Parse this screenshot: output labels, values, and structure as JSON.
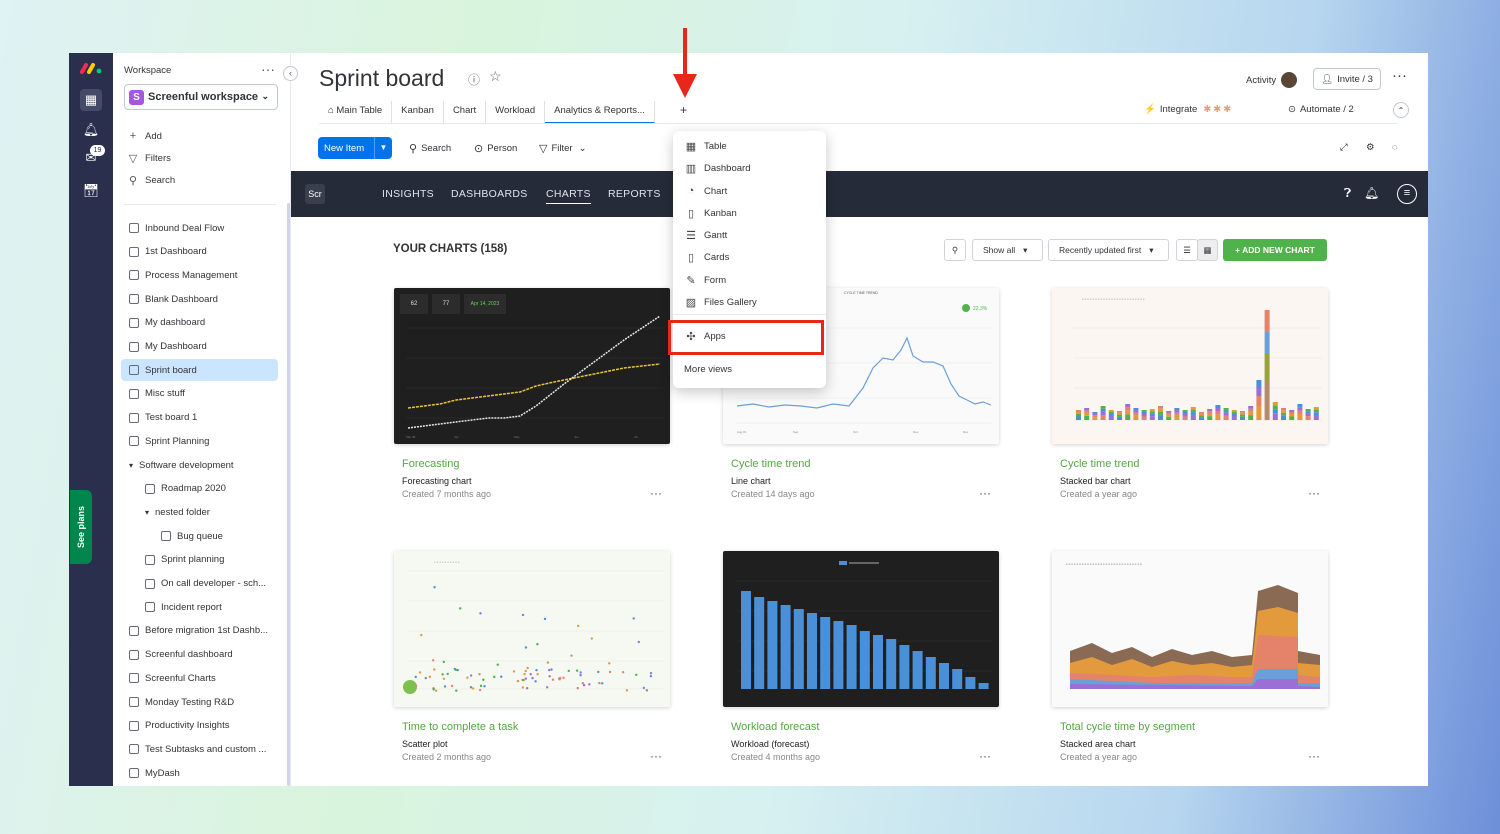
{
  "sidebar": {
    "workspace_label": "Workspace",
    "workspace_name": "Screenful workspace",
    "workspace_initial": "S",
    "actions": [
      {
        "label": "Add",
        "icon": "plus-icon"
      },
      {
        "label": "Filters",
        "icon": "filter-icon"
      },
      {
        "label": "Search",
        "icon": "search-icon"
      }
    ],
    "items": [
      "Inbound Deal Flow",
      "1st Dashboard",
      "Process Management",
      "Blank Dashboard",
      "My dashboard",
      "My Dashboard",
      "Sprint board",
      "Misc stuff",
      "Test board 1",
      "Sprint Planning",
      "Software development",
      "Roadmap 2020",
      "nested folder",
      "Bug queue",
      "Sprint planning",
      "On call developer - sch...",
      "Incident report",
      "Before migration 1st Dashb...",
      "Screenful dashboard",
      "Screenful Charts",
      "Monday Testing R&D",
      "Productivity Insights",
      "Test Subtasks and custom ...",
      "MyDash"
    ],
    "selected": "Sprint board"
  },
  "rail": {
    "see_plans": "See plans",
    "notif_count": "19"
  },
  "header": {
    "title": "Sprint board",
    "activity": "Activity",
    "invite": "Invite / 3",
    "tabs": [
      "Main Table",
      "Kanban",
      "Chart",
      "Workload",
      "Analytics & Reports..."
    ],
    "active_tab": "Analytics & Reports...",
    "add_view": "+",
    "integrate": "Integrate",
    "automate": "Automate / 2"
  },
  "toolbar": {
    "new_item": "New Item",
    "search": "Search",
    "person": "Person",
    "filter": "Filter"
  },
  "screenful": {
    "logo": "Scr",
    "nav": [
      "INSIGHTS",
      "DASHBOARDS",
      "CHARTS",
      "REPORTS"
    ],
    "active": "CHARTS"
  },
  "charts_page": {
    "heading": "YOUR CHARTS (158)",
    "show_all": "Show all",
    "sort": "Recently updated first",
    "add_new": "+ ADD NEW CHART",
    "cards": [
      {
        "title": "Forecasting",
        "subtitle": "Forecasting chart",
        "date": "Created 7 months ago"
      },
      {
        "title": "Cycle time trend",
        "subtitle": "Line chart",
        "date": "Created 14 days ago"
      },
      {
        "title": "Cycle time trend",
        "subtitle": "Stacked bar chart",
        "date": "Created a year ago"
      },
      {
        "title": "Time to complete a task",
        "subtitle": "Scatter plot",
        "date": "Created 2 months ago"
      },
      {
        "title": "Workload forecast",
        "subtitle": "Workload (forecast)",
        "date": "Created 4 months ago"
      },
      {
        "title": "Total cycle time by segment",
        "subtitle": "Stacked area chart",
        "date": "Created a year ago"
      }
    ]
  },
  "add_view_menu": {
    "items": [
      {
        "label": "Table",
        "icon": "table-icon"
      },
      {
        "label": "Dashboard",
        "icon": "dashboard-icon"
      },
      {
        "label": "Chart",
        "icon": "chart-icon"
      },
      {
        "label": "Kanban",
        "icon": "kanban-icon"
      },
      {
        "label": "Gantt",
        "icon": "gantt-icon"
      },
      {
        "label": "Cards",
        "icon": "cards-icon"
      },
      {
        "label": "Form",
        "icon": "form-icon"
      },
      {
        "label": "Files Gallery",
        "icon": "gallery-icon"
      },
      {
        "label": "Apps",
        "icon": "puzzle-icon"
      }
    ],
    "more": "More views",
    "highlighted": "Apps"
  },
  "thumb_text": {
    "fc_stats": [
      "62",
      "77",
      "Apr 14, 2023"
    ],
    "ct_percent": "22.3%"
  },
  "colors": {
    "accent": "#0073ea",
    "green": "#4fb24a",
    "highlight": "#e8261a",
    "nav_bg": "#252b39",
    "rail": "#292f4c"
  }
}
